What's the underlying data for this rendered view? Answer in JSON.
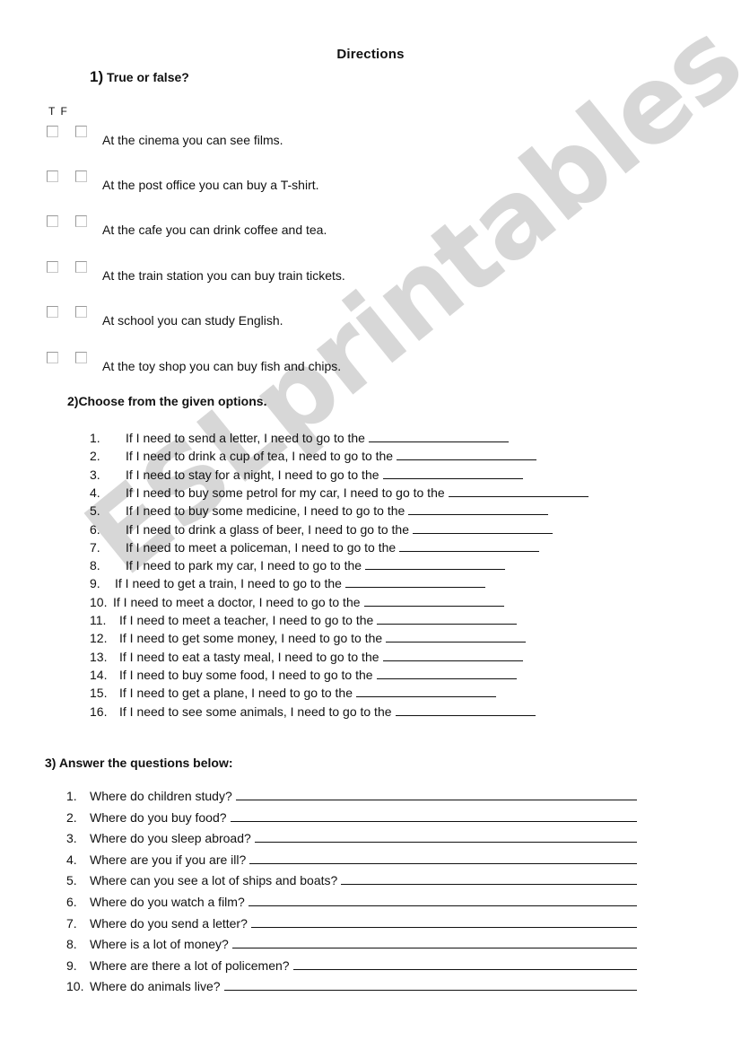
{
  "title": "Directions",
  "watermark": "ESLprintables.com",
  "section1": {
    "number": "1)",
    "heading": "True or false?",
    "column_labels": "T  F",
    "items": [
      "At the cinema you can see films.",
      "At the post office you can buy a T-shirt.",
      "At the cafe you can drink coffee and tea.",
      "At the train station you can buy train tickets.",
      "At school you can study English.",
      "At the toy shop you can buy fish and chips."
    ]
  },
  "section2": {
    "heading": "2)Choose from the given options.",
    "items": [
      {
        "num": "1.",
        "text": "If I need to send a letter, I need to go to the"
      },
      {
        "num": "2.",
        "text": "If I need to drink a cup of tea, I need to go to the"
      },
      {
        "num": "3.",
        "text": "If I need to stay for a night, I need to go to the"
      },
      {
        "num": "4.",
        "text": "If I need to buy some petrol for my car, I need to go to the"
      },
      {
        "num": "5.",
        "text": "If I need to buy some medicine, I need to go to the"
      },
      {
        "num": "6.",
        "text": "If I need to drink a glass of beer, I need to go to the"
      },
      {
        "num": "7.",
        "text": "If I need to meet a policeman, I need to go to the"
      },
      {
        "num": "8.",
        "text": "If I need to park my car, I need to go to the"
      },
      {
        "num": "9.",
        "text": "If I need to get a train, I need to go to the"
      },
      {
        "num": "10.",
        "text": "If I need to meet a doctor, I need to go to the"
      },
      {
        "num": "11.",
        "text": "If I need to meet a teacher, I need to go to the"
      },
      {
        "num": "12.",
        "text": "If I need to get some money, I need to go to the"
      },
      {
        "num": "13.",
        "text": "If I need to eat a tasty meal, I need to go to the"
      },
      {
        "num": "14.",
        "text": "If I need to buy some food, I need to go to the"
      },
      {
        "num": "15.",
        "text": "If I need to get a plane, I need to go to the"
      },
      {
        "num": "16.",
        "text": "If I need to see some animals, I need to go to the"
      }
    ]
  },
  "section3": {
    "heading": "3) Answer the questions below:",
    "items": [
      {
        "num": "1.",
        "text": "Where do children study?"
      },
      {
        "num": "2.",
        "text": "Where do you buy food?"
      },
      {
        "num": "3.",
        "text": "Where do you sleep abroad?"
      },
      {
        "num": "4.",
        "text": "Where are you if you are ill?"
      },
      {
        "num": "5.",
        "text": "Where can you see a lot of ships and boats?"
      },
      {
        "num": "6.",
        "text": "Where do you watch a film?"
      },
      {
        "num": "7.",
        "text": "Where do you send a letter?"
      },
      {
        "num": "8.",
        "text": "Where is a lot of money?"
      },
      {
        "num": "9.",
        "text": "Where are there a lot of policemen?"
      },
      {
        "num": "10.",
        "text": "Where do animals live?"
      }
    ]
  }
}
